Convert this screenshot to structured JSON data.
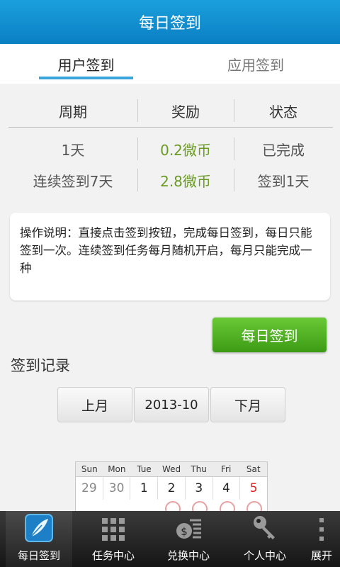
{
  "title": "每日签到",
  "tabs": [
    {
      "label": "用户签到",
      "active": true
    },
    {
      "label": "应用签到",
      "active": false
    }
  ],
  "table": {
    "headers": [
      "周期",
      "奖励",
      "状态"
    ],
    "rows": [
      [
        "1天",
        "0.2微币",
        "已完成"
      ],
      [
        "连续签到7天",
        "2.8微币",
        "签到1天"
      ]
    ]
  },
  "description": "操作说明：直接点击签到按钮，完成每日签到，每日只能签到一次。连续签到任务每月随机开启，每月只能完成一种",
  "checkin_button": "每日签到",
  "record_title": "签到记录",
  "month_nav": {
    "prev": "上月",
    "current": "2013-10",
    "next": "下月"
  },
  "calendar": {
    "weekdays": [
      "Sun",
      "Mon",
      "Tue",
      "Wed",
      "Thu",
      "Fri",
      "Sat"
    ],
    "first_row": [
      "29",
      "30",
      "1",
      "2",
      "3",
      "4",
      "5"
    ]
  },
  "bottom_nav": [
    {
      "label": "每日签到",
      "icon": "feather-icon",
      "active": true
    },
    {
      "label": "任务中心",
      "icon": "grid-icon",
      "active": false
    },
    {
      "label": "兑换中心",
      "icon": "exchange-icon",
      "active": false
    },
    {
      "label": "个人中心",
      "icon": "key-icon",
      "active": false
    },
    {
      "label": "展开",
      "icon": "more-icon",
      "active": false
    }
  ],
  "colors": {
    "titlebar": "#0b7fc4",
    "accent": "#3aa4dc",
    "reward_green": "#6a9a22",
    "button_green": "#3c9b14",
    "saturday_red": "#d22222"
  }
}
